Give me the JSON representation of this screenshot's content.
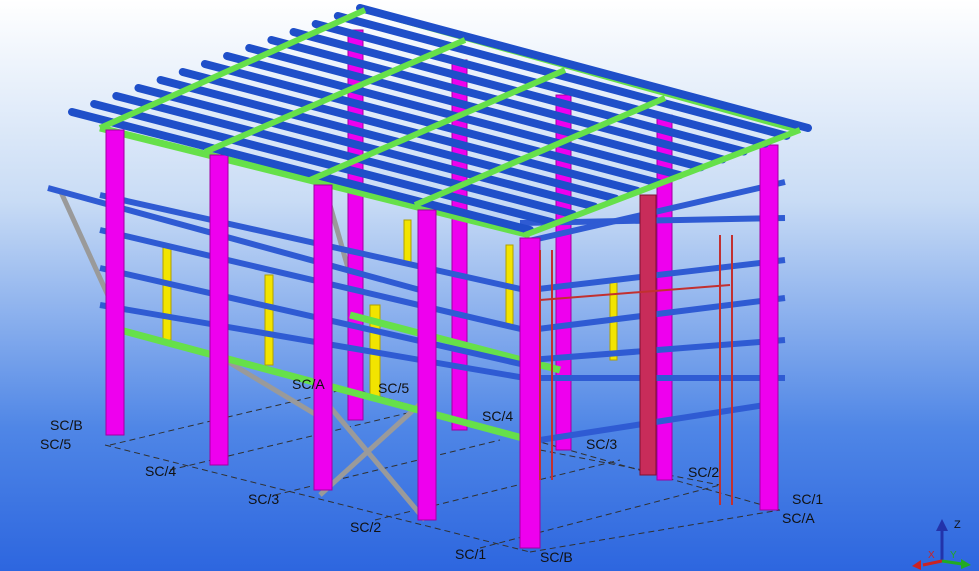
{
  "view": {
    "colors": {
      "sky_top": "#ffffff",
      "sky_bottom": "#2d66df",
      "column": "#ee00ee",
      "rafter": "#2f5bd3",
      "purlin": "#1f4fc9",
      "eave_beam": "#66e04a",
      "bracing": "#9a9a9a",
      "ladder": "#c23030",
      "yellow_member": "#f2e400",
      "gridline": "#303030",
      "orange_member": "#e0601a"
    },
    "grid_labels": [
      "SC/B",
      "SC/5",
      "SC/4",
      "SC/3",
      "SC/2",
      "SC/1",
      "SC/B",
      "SC/A",
      "SC/5",
      "SC/4",
      "SC/3",
      "SC/2",
      "SC/1",
      "SC/A"
    ],
    "axis": {
      "z": "Z",
      "x": "X",
      "y": "Y"
    }
  }
}
